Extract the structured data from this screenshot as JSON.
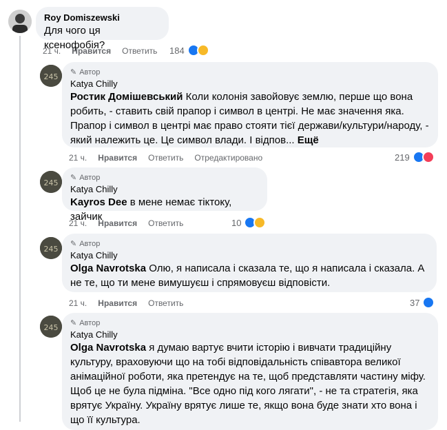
{
  "comments": [
    {
      "author": "Roy Domiszewski",
      "text": "Для чого ця ксенофобія?",
      "time": "21 ч.",
      "like": "Нравится",
      "reply": "Ответить",
      "reactions": "184"
    },
    {
      "badge": "Автор",
      "author": "Katya Chilly",
      "mention": "Ростик Домішевський",
      "text": "Коли колонія завойовує землю, перше що вона робить, - ставить свій прапор і символ в центрі. Не має значення яка. Прапор і символ в центрі має право стояти тієї держави/культури/народу, - який належить це. Це символ влади. І відпов...",
      "more": "Ещё",
      "time": "21 ч.",
      "like": "Нравится",
      "reply": "Ответить",
      "edited": "Отредактировано",
      "reactions": "219"
    },
    {
      "badge": "Автор",
      "author": "Katya Chilly",
      "mention": "Kayros Dee",
      "text": "в мене немає тіктоку, зайчик",
      "time": "21 ч.",
      "like": "Нравится",
      "reply": "Ответить",
      "reactions": "10"
    },
    {
      "badge": "Автор",
      "author": "Katya Chilly",
      "mention": "Olga Navrotska",
      "text": "Олю, я написала і сказала те, що я написала і сказала. А не те, що ти мене вимушуєш і спрямовуєш відповісти.",
      "time": "21 ч.",
      "like": "Нравится",
      "reply": "Ответить",
      "reactions": "37"
    },
    {
      "badge": "Автор",
      "author": "Katya Chilly",
      "mention": "Olga Navrotska",
      "text": "я думаю вартує вчити історію і вивчати традиційну культуру, враховуючи що на тобі відповідальність співавтора великої анімаційної роботи, яка претендує на те, щоб представляти частину міфу. Щоб це не була підміна. \"Все одно під кого лягати\", - не та стратегія, яка врятує Україну. Україну врятує лише те, якщо вона буде знати хто вона і що її культура."
    }
  ]
}
